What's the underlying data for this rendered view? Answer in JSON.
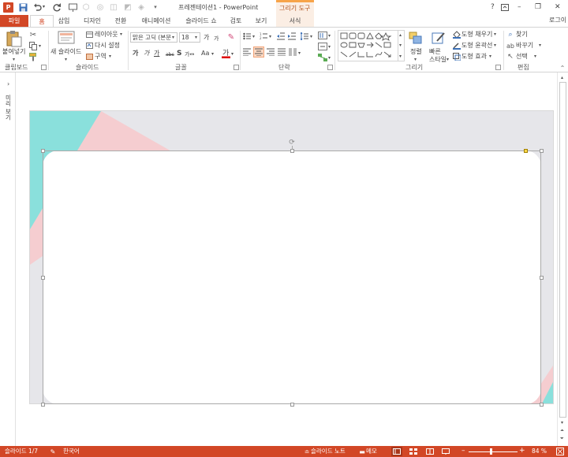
{
  "window": {
    "title": "프레젠테이션1 - PowerPoint",
    "context_tab": "그리기 도구",
    "help": "?",
    "minimize": "–",
    "restore": "❐",
    "close": "✕",
    "login": "로그이"
  },
  "tabs": [
    "파일",
    "홈",
    "삽입",
    "디자인",
    "전환",
    "애니메이션",
    "슬라이드 쇼",
    "검토",
    "보기",
    "서식"
  ],
  "ribbon": {
    "clipboard": {
      "paste": "붙여넣기",
      "group": "클립보드"
    },
    "slides": {
      "new_slide": "새 슬라이드",
      "layout": "레이아웃",
      "reset": "다시 설정",
      "section": "구역",
      "group": "슬라이드"
    },
    "font": {
      "name": "맑은 고딕 (본문",
      "size": "18",
      "group": "글꼴",
      "aa": "Aa",
      "grow": "가",
      "shrink": "가"
    },
    "paragraph": {
      "group": "단락"
    },
    "drawing": {
      "arrange": "정렬",
      "quick_styles": "빠른 스타일",
      "shape_fill": "도형 채우기",
      "shape_outline": "도형 윤곽선",
      "shape_effects": "도형 효과",
      "group": "그리기"
    },
    "editing": {
      "find": "찾기",
      "replace": "바꾸기",
      "select": "선택",
      "group": "편집"
    }
  },
  "thumb_pane": {
    "label": "미리 보기"
  },
  "status": {
    "slide": "슬라이드 1/7",
    "language": "한국어",
    "notes": "슬라이드 노트",
    "comments": "메모",
    "zoom": "84 %"
  },
  "colors": {
    "accent": "#d24726",
    "teal": "#8ae0dc",
    "pink": "#f5cdd0",
    "slide_bg": "#e6e6ea"
  }
}
